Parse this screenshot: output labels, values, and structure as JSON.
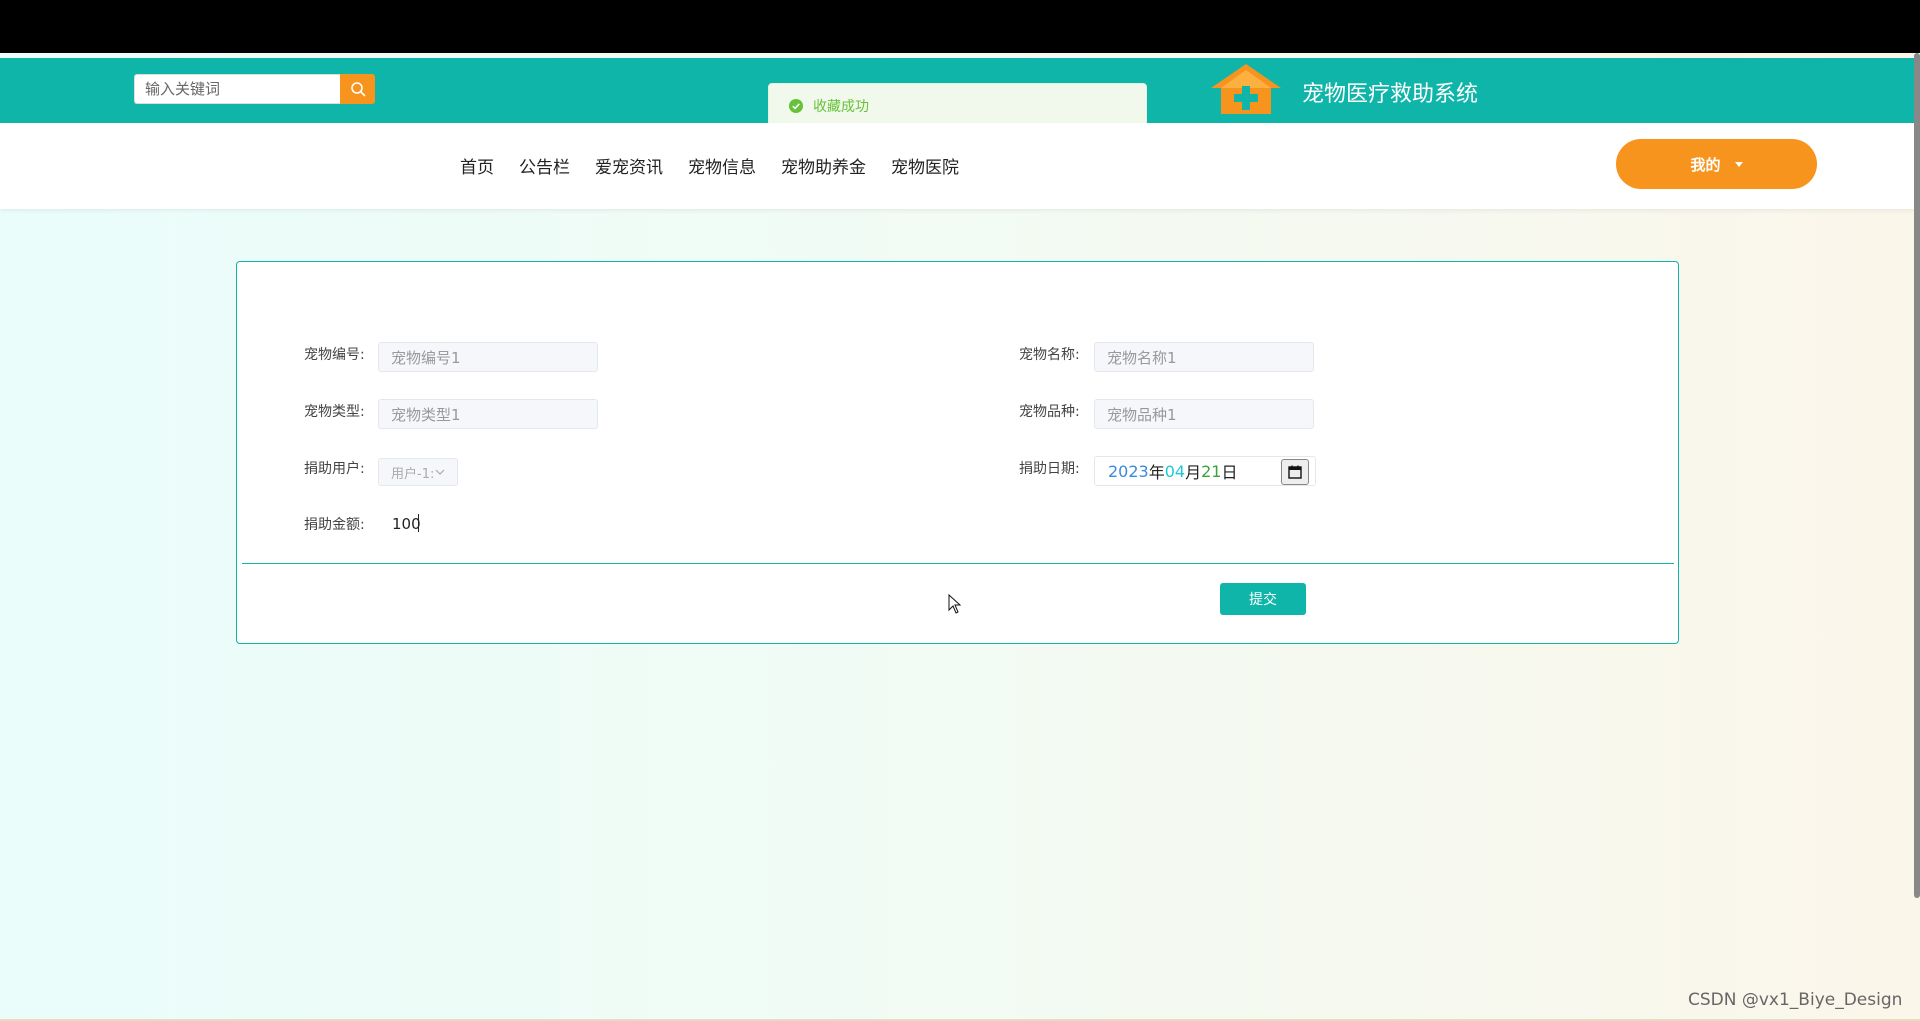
{
  "header": {
    "search_placeholder": "输入关键词",
    "site_title": "宠物医疗救助系统",
    "accent_color": "#0fb5a8",
    "orange_color": "#f7941d"
  },
  "toast": {
    "message": "收藏成功",
    "icon": "success-check-icon"
  },
  "nav": {
    "items": [
      "首页",
      "公告栏",
      "爱宠资讯",
      "宠物信息",
      "宠物助养金",
      "宠物医院"
    ],
    "mine_label": "我的"
  },
  "form": {
    "pet_id": {
      "label": "宠物编号:",
      "value": "宠物编号1"
    },
    "pet_name": {
      "label": "宠物名称:",
      "value": "宠物名称1"
    },
    "pet_type": {
      "label": "宠物类型:",
      "value": "宠物类型1"
    },
    "pet_breed": {
      "label": "宠物品种:",
      "value": "宠物品种1"
    },
    "donor": {
      "label": "捐助用户:",
      "value": "用户-1:"
    },
    "donate_date": {
      "label": "捐助日期:",
      "year": "2023",
      "year_unit": "年",
      "month": "04",
      "month_unit": "月",
      "day": "21",
      "day_unit": "日"
    },
    "amount": {
      "label": "捐助金额:",
      "value": "100"
    },
    "submit_label": "提交"
  },
  "watermark": "CSDN @vx1_Biye_Design"
}
